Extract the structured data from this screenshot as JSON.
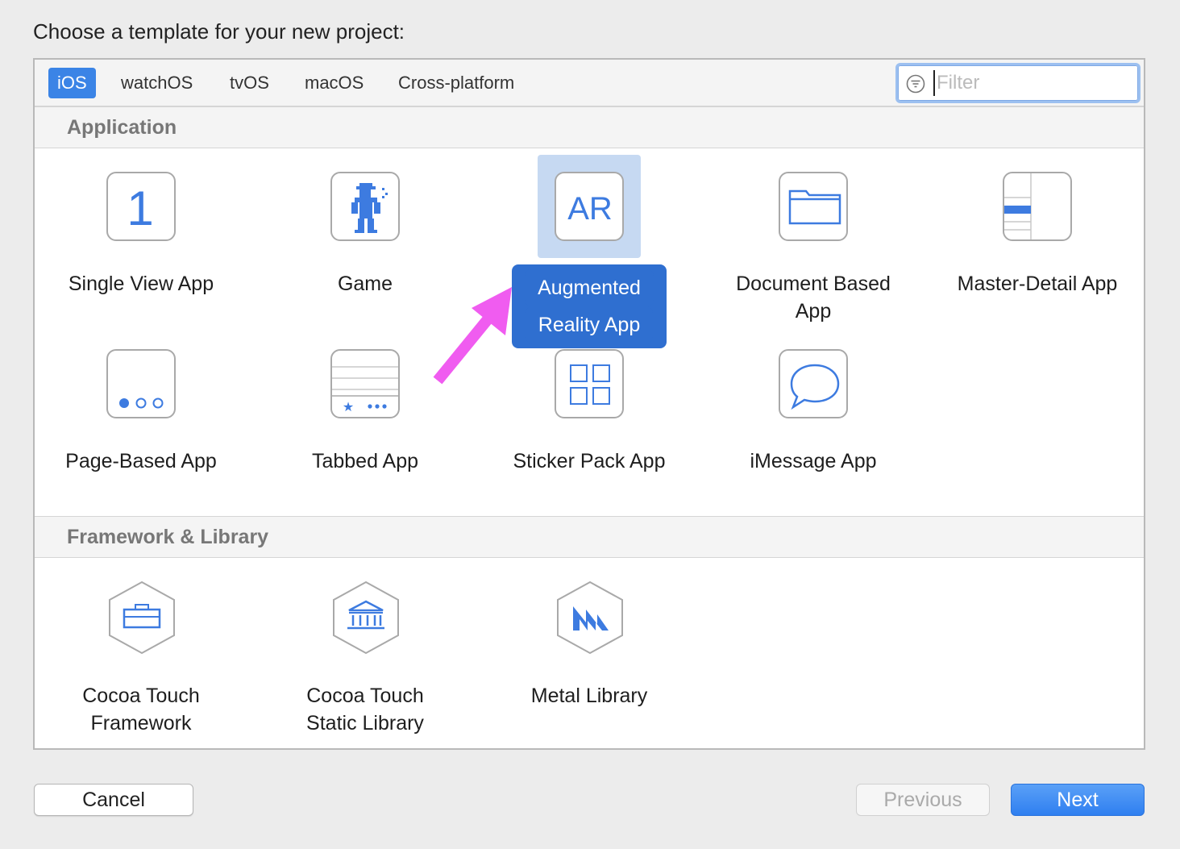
{
  "dialog": {
    "title": "Choose a template for your new project:"
  },
  "platform_tabs": [
    {
      "label": "iOS",
      "selected": true
    },
    {
      "label": "watchOS",
      "selected": false
    },
    {
      "label": "tvOS",
      "selected": false
    },
    {
      "label": "macOS",
      "selected": false
    },
    {
      "label": "Cross-platform",
      "selected": false
    }
  ],
  "filter": {
    "placeholder": "Filter",
    "value": "",
    "icon": "filter-icon"
  },
  "sections": {
    "application": {
      "header": "Application",
      "items": [
        {
          "label": "Single View App",
          "icon": "single-view-icon"
        },
        {
          "label": "Game",
          "icon": "game-icon"
        },
        {
          "label": "Augmented\nReality App",
          "line1": "Augmented",
          "line2": "Reality App",
          "icon": "ar-icon",
          "icon_text": "AR",
          "selected": true
        },
        {
          "label": "Document Based App",
          "line1": "Document Based",
          "line2": "App",
          "icon": "folder-icon"
        },
        {
          "label": "Master-Detail App",
          "icon": "master-detail-icon"
        },
        {
          "label": "Page-Based App",
          "icon": "page-dots-icon"
        },
        {
          "label": "Tabbed App",
          "icon": "tabbed-icon"
        },
        {
          "label": "Sticker Pack App",
          "icon": "sticker-grid-icon"
        },
        {
          "label": "iMessage App",
          "icon": "message-bubble-icon"
        }
      ],
      "single_view_icon_text": "1"
    },
    "framework": {
      "header": "Framework & Library",
      "items": [
        {
          "line1": "Cocoa Touch",
          "line2": "Framework",
          "icon": "toolbox-icon"
        },
        {
          "line1": "Cocoa Touch",
          "line2": "Static Library",
          "icon": "library-building-icon"
        },
        {
          "label": "Metal Library",
          "icon": "metal-icon"
        }
      ]
    }
  },
  "buttons": {
    "cancel": "Cancel",
    "previous": "Previous",
    "next": "Next"
  },
  "colors": {
    "accent": "#3b84e6",
    "icon_blue": "#3d7be0",
    "annotation_arrow": "#f05cf0",
    "selection_bg": "#c6d9f2",
    "selected_label_bg": "#2f6fd0"
  }
}
